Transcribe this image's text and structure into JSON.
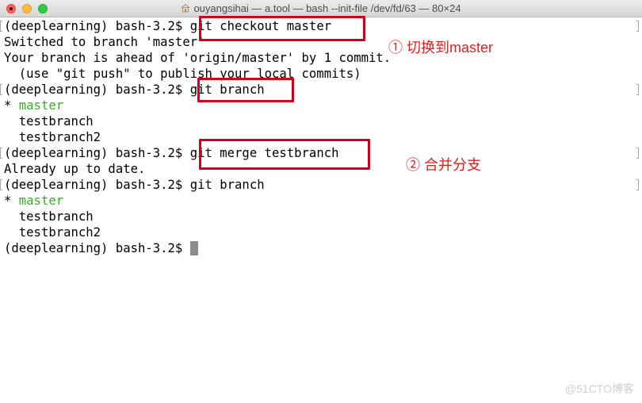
{
  "window": {
    "title": "ouyangsihai — a.tool — bash --init-file /dev/fd/63 — 80×24",
    "buttons": {
      "close": "close",
      "minimize": "minimize",
      "zoom": "zoom"
    }
  },
  "terminal": {
    "prompt": "(deeplearning) bash-3.2$ ",
    "lines": [
      {
        "prefix": "(deeplearning) bash-3.2$ ",
        "text": "git checkout master"
      },
      {
        "text": "Switched to branch 'master'"
      },
      {
        "text": "Your branch is ahead of 'origin/master' by 1 commit."
      },
      {
        "text": "  (use \"git push\" to publish your local commits)"
      },
      {
        "prefix": "(deeplearning) bash-3.2$ ",
        "text": "git branch"
      },
      {
        "prefix": "* ",
        "text": "master"
      },
      {
        "text": "  testbranch"
      },
      {
        "text": "  testbranch2"
      },
      {
        "prefix": "(deeplearning) bash-3.2$ ",
        "text": "git merge testbranch"
      },
      {
        "text": "Already up to date."
      },
      {
        "prefix": "(deeplearning) bash-3.2$ ",
        "text": "git branch"
      },
      {
        "prefix": "* ",
        "text": "master"
      },
      {
        "text": "  testbranch"
      },
      {
        "text": "  testbranch2"
      },
      {
        "prefix": "(deeplearning) bash-3.2$ ",
        "text": ""
      }
    ]
  },
  "annotations": {
    "note1": "① 切换到master",
    "note2": "② 合并分支"
  },
  "colors": {
    "current_branch": "#2fb41c",
    "annotation": "#d0021b"
  },
  "watermark": "@51CTO博客"
}
